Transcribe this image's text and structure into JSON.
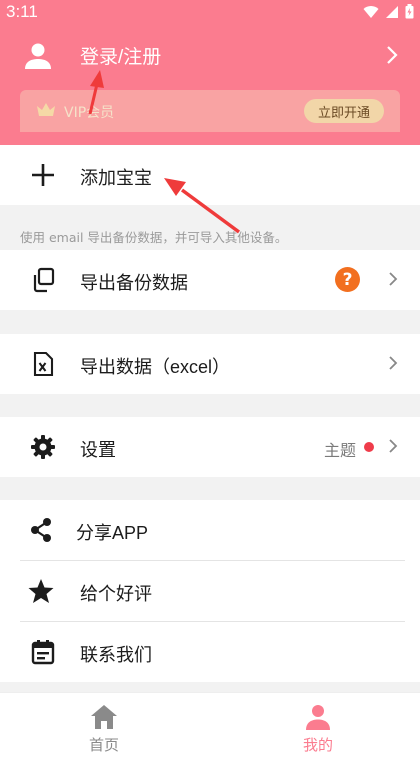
{
  "status_bar": {
    "time": "3:11"
  },
  "colors": {
    "brand": "#fb7c8f",
    "badge_orange": "#f26f1f",
    "theme_dot": "#ef3c4a",
    "arrow_red": "#ef3b3b"
  },
  "header": {
    "login_label": "登录/注册",
    "vip_label": "VIP会员",
    "vip_button": "立即开通"
  },
  "add_baby": {
    "label": "添加宝宝"
  },
  "hint": "使用 email 导出备份数据，并可导入其他设备。",
  "menu": {
    "export_backup": "导出备份数据",
    "help_badge": "?",
    "export_excel": "导出数据（excel）",
    "settings": "设置",
    "theme": "主题",
    "share": "分享APP",
    "rate": "给个好评",
    "contact": "联系我们"
  },
  "tabbar": {
    "home": "首页",
    "mine": "我的"
  },
  "icons": [
    "person-icon",
    "crown-icon",
    "plus-icon",
    "copy-icon",
    "excel-file-icon",
    "gear-icon",
    "share-icon",
    "star-icon",
    "calendar-icon",
    "home-icon",
    "chevron-right-icon",
    "wifi-icon",
    "signal-icon",
    "battery-icon"
  ]
}
